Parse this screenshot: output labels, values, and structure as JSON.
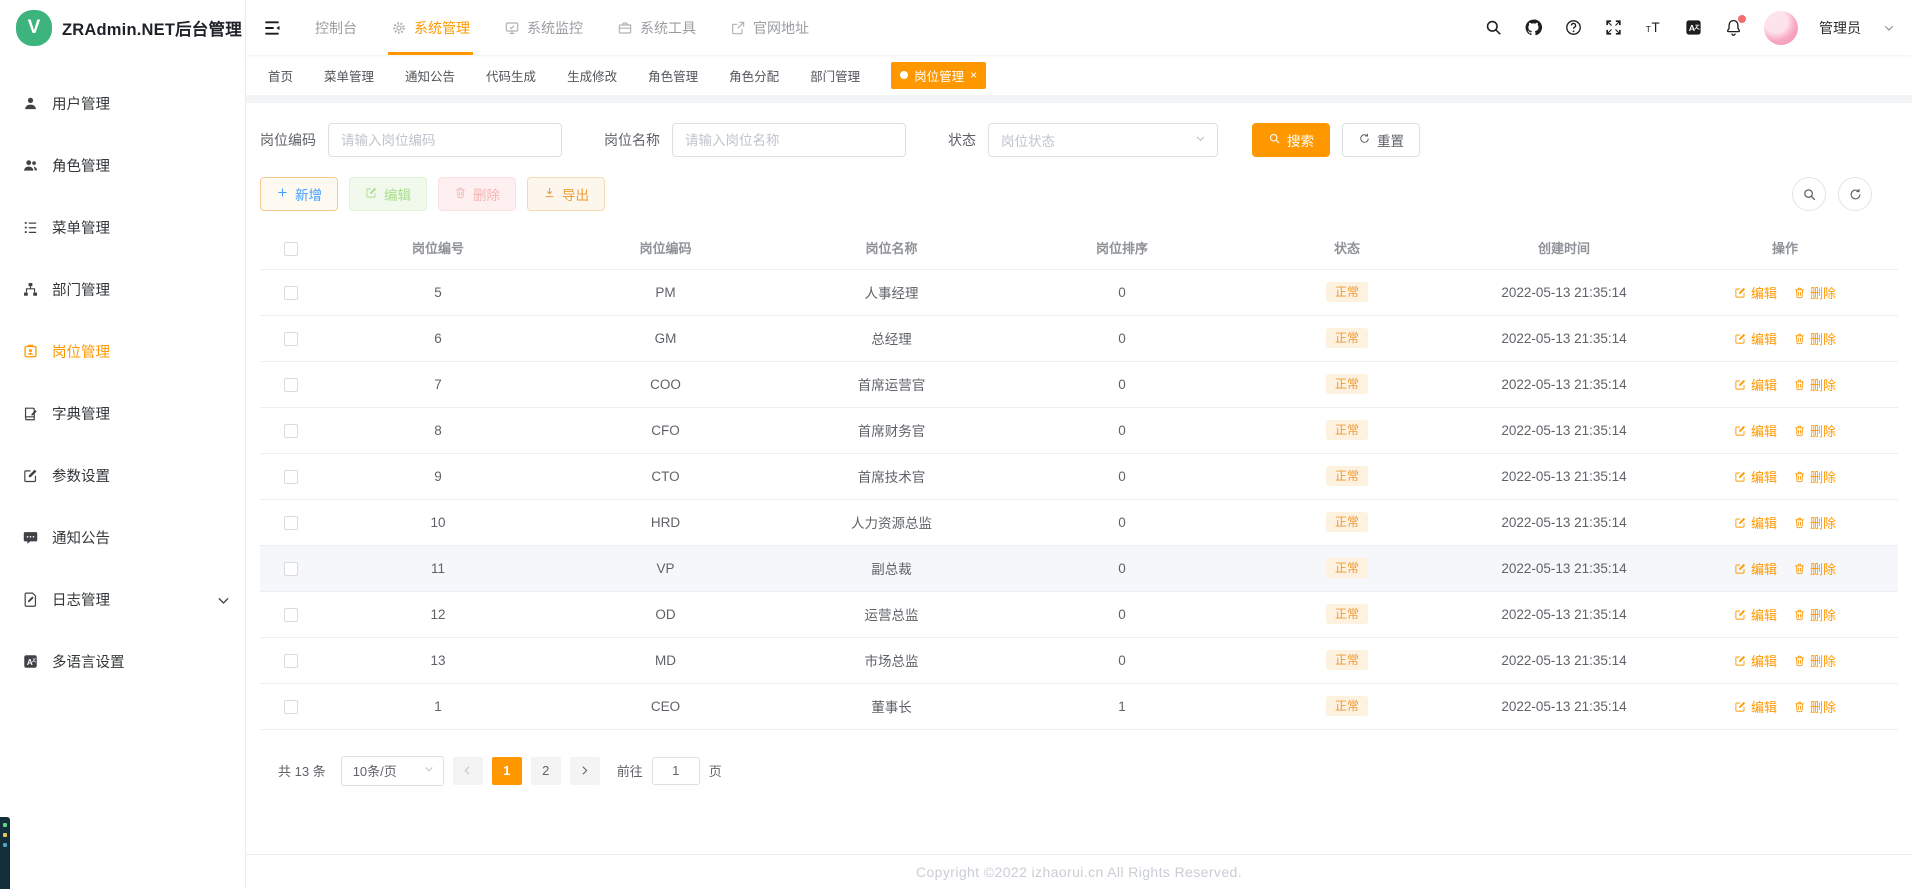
{
  "theme": {
    "accent": "#ff9800",
    "logo_green": "#3db37d",
    "status_badge_bg": "#fdf1e0",
    "status_badge_text": "#f09b31",
    "danger_dot": "#f56c6c"
  },
  "app": {
    "title": "ZRAdmin.NET后台管理",
    "logo_letter": "V"
  },
  "topnav": {
    "items": [
      {
        "key": "console",
        "label": "控制台",
        "icon": null,
        "active": false
      },
      {
        "key": "system-manage",
        "label": "系统管理",
        "icon": "gear-icon",
        "active": true
      },
      {
        "key": "system-monitor",
        "label": "系统监控",
        "icon": "monitor-icon",
        "active": false
      },
      {
        "key": "system-tools",
        "label": "系统工具",
        "icon": "toolbox-icon",
        "active": false
      },
      {
        "key": "official-site",
        "label": "官网地址",
        "icon": "external-link-icon",
        "active": false
      }
    ],
    "right_icons": [
      "search-icon",
      "github-icon",
      "help-icon",
      "fullscreen-icon",
      "font-size-icon",
      "language-icon",
      "bell-icon"
    ],
    "user": {
      "name": "管理员"
    }
  },
  "sidebar": {
    "items": [
      {
        "key": "user-management",
        "label": "用户管理",
        "icon": "user-icon",
        "active": false,
        "expandable": false
      },
      {
        "key": "role-management",
        "label": "角色管理",
        "icon": "users-icon",
        "active": false,
        "expandable": false
      },
      {
        "key": "menu-management",
        "label": "菜单管理",
        "icon": "menu-tree-icon",
        "active": false,
        "expandable": false
      },
      {
        "key": "dept-management",
        "label": "部门管理",
        "icon": "org-tree-icon",
        "active": false,
        "expandable": false
      },
      {
        "key": "post-management",
        "label": "岗位管理",
        "icon": "post-badge-icon",
        "active": true,
        "expandable": false
      },
      {
        "key": "dict-management",
        "label": "字典管理",
        "icon": "dictionary-icon",
        "active": false,
        "expandable": false
      },
      {
        "key": "param-settings",
        "label": "参数设置",
        "icon": "settings-edit-icon",
        "active": false,
        "expandable": false
      },
      {
        "key": "notice",
        "label": "通知公告",
        "icon": "announcement-icon",
        "active": false,
        "expandable": false
      },
      {
        "key": "log-management",
        "label": "日志管理",
        "icon": "log-icon",
        "active": false,
        "expandable": true
      },
      {
        "key": "i18n-settings",
        "label": "多语言设置",
        "icon": "translate-icon",
        "active": false,
        "expandable": false
      }
    ]
  },
  "tabs": {
    "items": [
      {
        "label": "首页",
        "active": false
      },
      {
        "label": "菜单管理",
        "active": false
      },
      {
        "label": "通知公告",
        "active": false
      },
      {
        "label": "代码生成",
        "active": false
      },
      {
        "label": "生成修改",
        "active": false
      },
      {
        "label": "角色管理",
        "active": false
      },
      {
        "label": "角色分配",
        "active": false
      },
      {
        "label": "部门管理",
        "active": false
      },
      {
        "label": "岗位管理",
        "active": true,
        "closable": true
      }
    ],
    "close_glyph": "×"
  },
  "filter": {
    "code_label": "岗位编码",
    "code_placeholder": "请输入岗位编码",
    "code_value": "",
    "name_label": "岗位名称",
    "name_placeholder": "请输入岗位名称",
    "name_value": "",
    "status_label": "状态",
    "status_placeholder": "岗位状态",
    "search_label": "搜索",
    "reset_label": "重置"
  },
  "toolbar": {
    "add_label": "新增",
    "edit_label": "编辑",
    "delete_label": "删除",
    "export_label": "导出"
  },
  "table": {
    "headers": [
      "岗位编号",
      "岗位编码",
      "岗位名称",
      "岗位排序",
      "状态",
      "创建时间",
      "操作"
    ],
    "edit_label": "编辑",
    "delete_label": "删除",
    "rows": [
      {
        "id": "5",
        "code": "PM",
        "name": "人事经理",
        "sort": "0",
        "status": "正常",
        "created": "2022-05-13 21:35:14",
        "highlight": false
      },
      {
        "id": "6",
        "code": "GM",
        "name": "总经理",
        "sort": "0",
        "status": "正常",
        "created": "2022-05-13 21:35:14",
        "highlight": false
      },
      {
        "id": "7",
        "code": "COO",
        "name": "首席运营官",
        "sort": "0",
        "status": "正常",
        "created": "2022-05-13 21:35:14",
        "highlight": false
      },
      {
        "id": "8",
        "code": "CFO",
        "name": "首席财务官",
        "sort": "0",
        "status": "正常",
        "created": "2022-05-13 21:35:14",
        "highlight": false
      },
      {
        "id": "9",
        "code": "CTO",
        "name": "首席技术官",
        "sort": "0",
        "status": "正常",
        "created": "2022-05-13 21:35:14",
        "highlight": false
      },
      {
        "id": "10",
        "code": "HRD",
        "name": "人力资源总监",
        "sort": "0",
        "status": "正常",
        "created": "2022-05-13 21:35:14",
        "highlight": false
      },
      {
        "id": "11",
        "code": "VP",
        "name": "副总裁",
        "sort": "0",
        "status": "正常",
        "created": "2022-05-13 21:35:14",
        "highlight": true
      },
      {
        "id": "12",
        "code": "OD",
        "name": "运营总监",
        "sort": "0",
        "status": "正常",
        "created": "2022-05-13 21:35:14",
        "highlight": false
      },
      {
        "id": "13",
        "code": "MD",
        "name": "市场总监",
        "sort": "0",
        "status": "正常",
        "created": "2022-05-13 21:35:14",
        "highlight": false
      },
      {
        "id": "1",
        "code": "CEO",
        "name": "董事长",
        "sort": "1",
        "status": "正常",
        "created": "2022-05-13 21:35:14",
        "highlight": false
      }
    ]
  },
  "pagination": {
    "total_label": "共 13 条",
    "page_size_label": "10条/页",
    "pages": [
      "1",
      "2"
    ],
    "active_page": "1",
    "goto_label": "前往",
    "goto_value": "1",
    "unit_label": "页"
  },
  "footer": {
    "copyright": "Copyright ©2022 izhaorui.cn All Rights Reserved."
  }
}
